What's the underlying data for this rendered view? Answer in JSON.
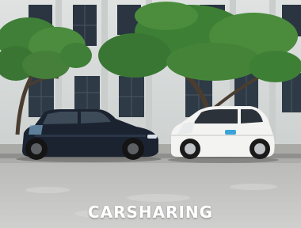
{
  "photo": {
    "caption": "CARSHARING",
    "subjects": {
      "left_car": "dark-hatchback",
      "right_car": "white-compact-car"
    },
    "colors": {
      "wall": "#d6d9d8",
      "window": "#2c3843",
      "tree_leaves": "#3e7f36",
      "road": "#bdbdbd",
      "sidewalk": "#a9aaa6",
      "left_car_body": "#1b2331",
      "right_car_body": "#f3f3f1",
      "caption_text": "#ffffff"
    }
  }
}
